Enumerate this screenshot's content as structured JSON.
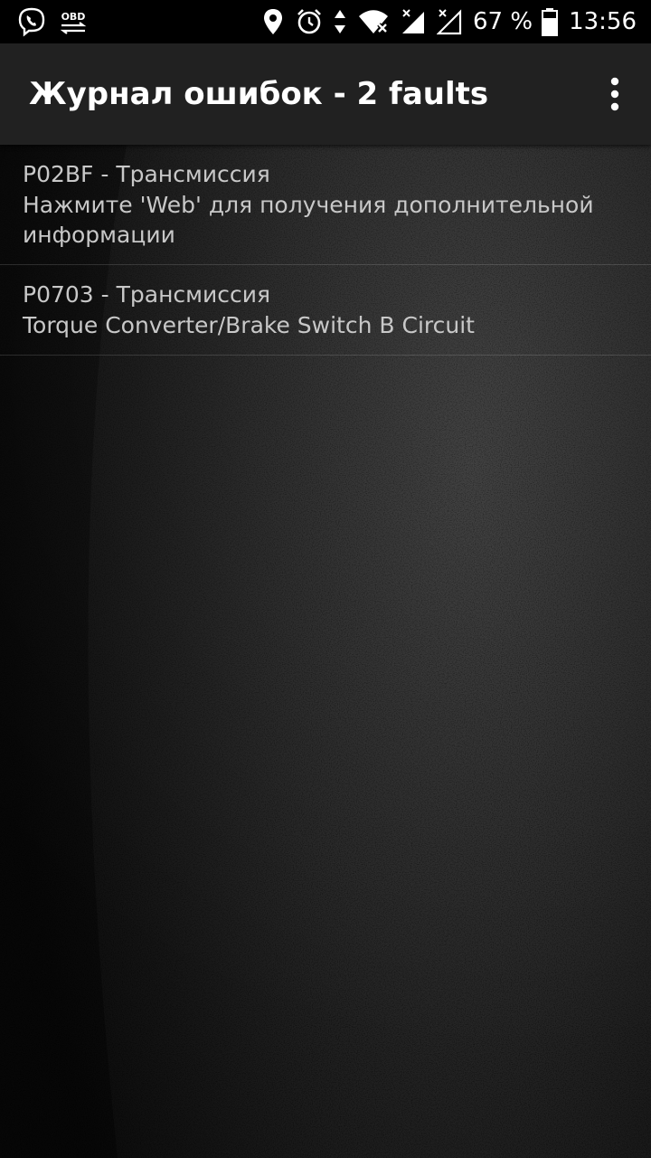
{
  "status_bar": {
    "left_icons": [
      "viber-icon",
      "obd-icon"
    ],
    "obd_label": "OBD",
    "right_icons": [
      "location-icon",
      "alarm-icon",
      "data-arrows-icon",
      "wifi-icon",
      "signal-sim1-icon",
      "signal-sim2-icon",
      "battery-icon"
    ],
    "battery_percent": "67 %",
    "time": "13:56"
  },
  "app_bar": {
    "title": "Журнал ошибок - 2 faults",
    "overflow_icon": "more-vert-icon"
  },
  "faults": [
    {
      "code": "P02BF - Трансмиссия",
      "description": "Нажмите 'Web' для получения дополнительной информации"
    },
    {
      "code": "P0703 - Трансмиссия",
      "description": "Torque Converter/Brake Switch B Circuit"
    }
  ],
  "colors": {
    "status_bar_bg": "#000000",
    "app_bar_bg": "#212121",
    "title_text": "#ffffff",
    "list_text": "#c8c8c8"
  }
}
